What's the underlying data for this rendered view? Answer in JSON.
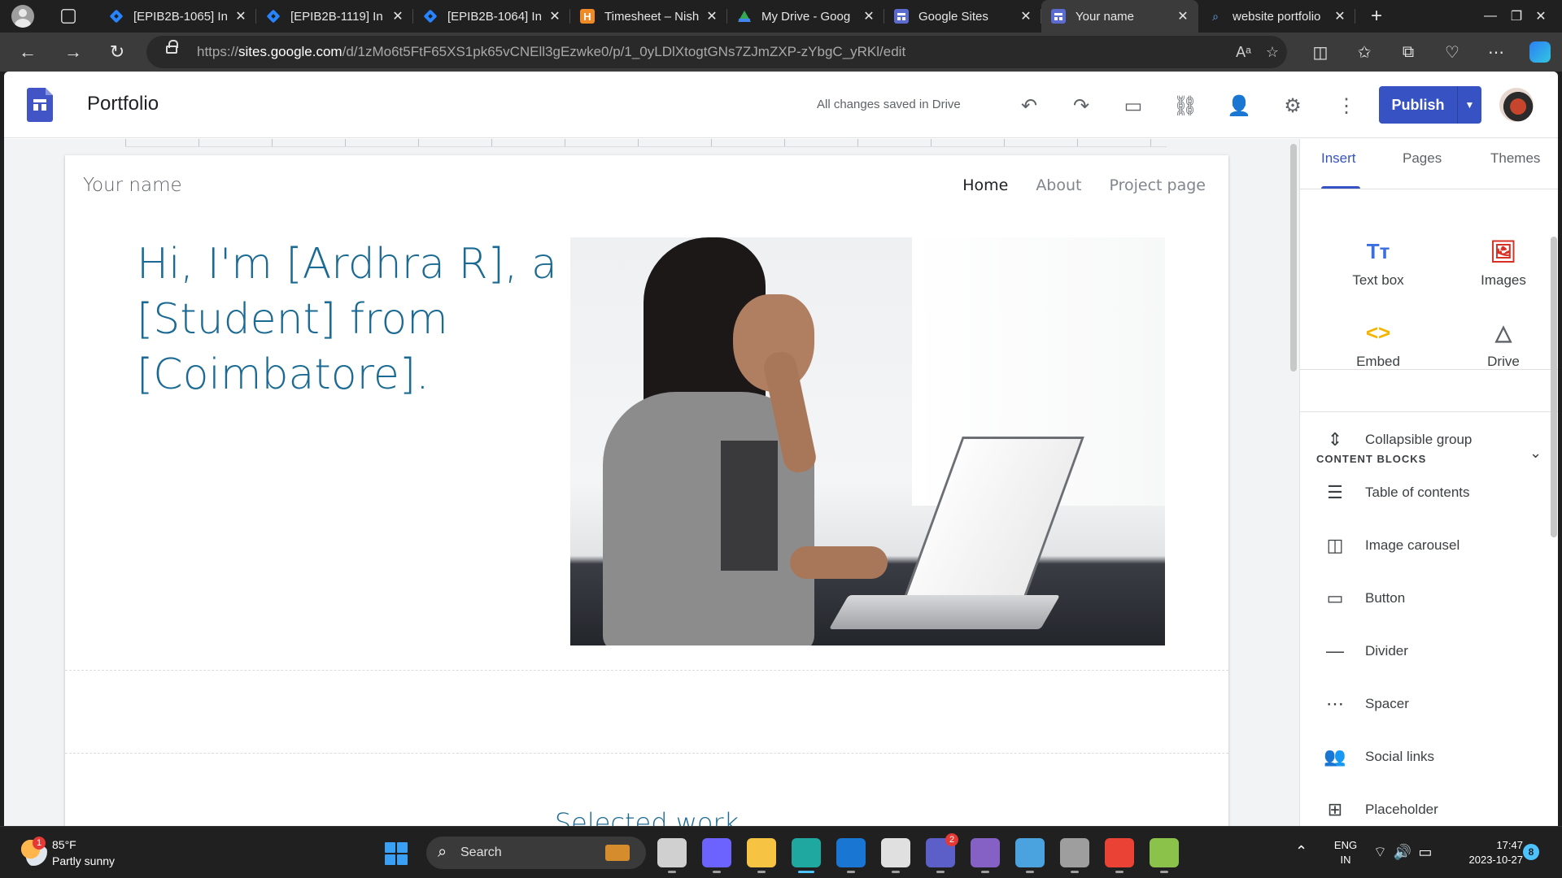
{
  "browser": {
    "tabs": [
      {
        "title": "[EPIB2B-1065] In",
        "icon": "jira-icon",
        "active": false
      },
      {
        "title": "[EPIB2B-1119] In",
        "icon": "jira-icon",
        "active": false
      },
      {
        "title": "[EPIB2B-1064] In",
        "icon": "jira-icon",
        "active": false
      },
      {
        "title": "Timesheet – Nish",
        "icon": "timesheet-icon",
        "active": false
      },
      {
        "title": "My Drive - Goog",
        "icon": "drive-icon",
        "active": false
      },
      {
        "title": "Google Sites",
        "icon": "sites-icon",
        "active": false
      },
      {
        "title": "Your name",
        "icon": "sites-icon",
        "active": true
      },
      {
        "title": "website portfolio",
        "icon": "search-icon",
        "active": false
      }
    ],
    "timesheet_glyph": "H",
    "close_glyph": "✕",
    "newtab_glyph": "+",
    "url_prefix": "https://",
    "url_host": "sites.google.com",
    "url_path": "/d/1zMo6t5FtF65XS1pk65vCNEll3gEzwke0/p/1_0yLDlXtogtGNs7ZJmZXP-zYbgC_yRKl/edit"
  },
  "editor": {
    "doc_title": "Portfolio",
    "save_status": "All changes saved in Drive",
    "publish_label": "Publish"
  },
  "site": {
    "name": "Your name",
    "nav": [
      "Home",
      "About",
      "Project page"
    ],
    "hero_text": "Hi, I'm [Ardhra R], a [Student] from [Coimbatore].",
    "section_heading": "Selected work"
  },
  "panel": {
    "tabs": [
      "Insert",
      "Pages",
      "Themes"
    ],
    "tiles": [
      {
        "label": "Text box",
        "icon": "text-box-icon",
        "glyph": "Tт",
        "color": "#3b6fe0"
      },
      {
        "label": "Images",
        "icon": "image-icon",
        "glyph": "🖼",
        "color": "#d93025"
      },
      {
        "label": "Embed",
        "icon": "embed-icon",
        "glyph": "<>",
        "color": "#f4b400"
      },
      {
        "label": "Drive",
        "icon": "drive-icon",
        "glyph": "△",
        "color": "#5f6368"
      }
    ],
    "content_blocks_title": "CONTENT BLOCKS",
    "content_blocks": [
      {
        "label": "Collapsible group",
        "icon": "collapsible-icon",
        "glyph": "⇕"
      },
      {
        "label": "Table of contents",
        "icon": "toc-icon",
        "glyph": "☰"
      },
      {
        "label": "Image carousel",
        "icon": "carousel-icon",
        "glyph": "◫"
      },
      {
        "label": "Button",
        "icon": "button-icon",
        "glyph": "▭"
      },
      {
        "label": "Divider",
        "icon": "divider-icon",
        "glyph": "—"
      },
      {
        "label": "Spacer",
        "icon": "spacer-icon",
        "glyph": "⋯"
      },
      {
        "label": "Social links",
        "icon": "people-icon",
        "glyph": "👥"
      },
      {
        "label": "Placeholder",
        "icon": "placeholder-icon",
        "glyph": "⊞"
      }
    ]
  },
  "taskbar": {
    "weather_temp": "85°F",
    "weather_desc": "Partly sunny",
    "weather_badge": "1",
    "search_label": "Search",
    "teams_badge": "2",
    "lang_line1": "ENG",
    "lang_line2": "IN",
    "time": "17:47",
    "date": "2023-10-27",
    "notifications": "8",
    "apps": [
      {
        "name": "task-view",
        "color": "#d0d0d0"
      },
      {
        "name": "meet-now",
        "color": "#6c63ff"
      },
      {
        "name": "file-explorer",
        "color": "#f6c342"
      },
      {
        "name": "edge",
        "color": "#1fa8a0"
      },
      {
        "name": "outlook",
        "color": "#1976d2"
      },
      {
        "name": "snipping-tool",
        "color": "#e0e0e0"
      },
      {
        "name": "teams",
        "color": "#5b5fc7"
      },
      {
        "name": "visual-studio",
        "color": "#8661c5"
      },
      {
        "name": "notepad",
        "color": "#4aa3df"
      },
      {
        "name": "settings",
        "color": "#9e9e9e"
      },
      {
        "name": "chrome",
        "color": "#ea4335"
      },
      {
        "name": "notepad-plus",
        "color": "#8bc34a"
      }
    ]
  }
}
